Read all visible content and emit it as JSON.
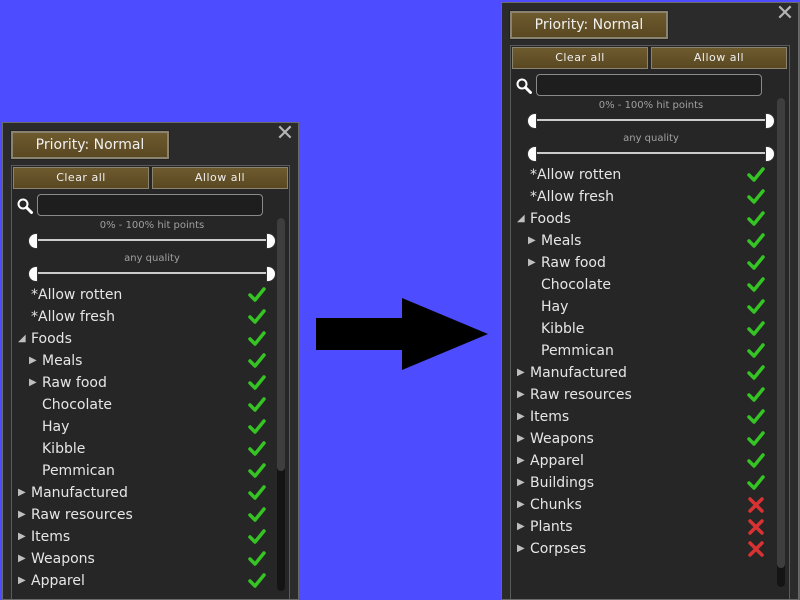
{
  "left": {
    "priority_label": "Priority: Normal",
    "clear_label": "Clear all",
    "allow_label": "Allow all",
    "search_value": "",
    "hitpoints_label": "0% - 100% hit points",
    "quality_label": "any quality",
    "rows": [
      {
        "label": "*Allow rotten",
        "indent": 0,
        "arrow": "none",
        "state": "allowed"
      },
      {
        "label": "*Allow fresh",
        "indent": 0,
        "arrow": "none",
        "state": "allowed"
      },
      {
        "label": "Foods",
        "indent": 0,
        "arrow": "expanded",
        "state": "allowed"
      },
      {
        "label": "Meals",
        "indent": 1,
        "arrow": "collapsed",
        "state": "allowed"
      },
      {
        "label": "Raw food",
        "indent": 1,
        "arrow": "collapsed",
        "state": "allowed"
      },
      {
        "label": "Chocolate",
        "indent": 1,
        "arrow": "none",
        "state": "allowed"
      },
      {
        "label": "Hay",
        "indent": 1,
        "arrow": "none",
        "state": "allowed"
      },
      {
        "label": "Kibble",
        "indent": 1,
        "arrow": "none",
        "state": "allowed"
      },
      {
        "label": "Pemmican",
        "indent": 1,
        "arrow": "none",
        "state": "allowed"
      },
      {
        "label": "Manufactured",
        "indent": 0,
        "arrow": "collapsed",
        "state": "allowed"
      },
      {
        "label": "Raw resources",
        "indent": 0,
        "arrow": "collapsed",
        "state": "allowed"
      },
      {
        "label": "Items",
        "indent": 0,
        "arrow": "collapsed",
        "state": "allowed"
      },
      {
        "label": "Weapons",
        "indent": 0,
        "arrow": "collapsed",
        "state": "allowed"
      },
      {
        "label": "Apparel",
        "indent": 0,
        "arrow": "collapsed",
        "state": "allowed"
      }
    ]
  },
  "right": {
    "priority_label": "Priority: Normal",
    "clear_label": "Clear all",
    "allow_label": "Allow all",
    "search_value": "",
    "hitpoints_label": "0% - 100% hit points",
    "quality_label": "any quality",
    "rows": [
      {
        "label": "*Allow rotten",
        "indent": 0,
        "arrow": "none",
        "state": "allowed"
      },
      {
        "label": "*Allow fresh",
        "indent": 0,
        "arrow": "none",
        "state": "allowed"
      },
      {
        "label": "Foods",
        "indent": 0,
        "arrow": "expanded",
        "state": "allowed"
      },
      {
        "label": "Meals",
        "indent": 1,
        "arrow": "collapsed",
        "state": "allowed"
      },
      {
        "label": "Raw food",
        "indent": 1,
        "arrow": "collapsed",
        "state": "allowed"
      },
      {
        "label": "Chocolate",
        "indent": 1,
        "arrow": "none",
        "state": "allowed"
      },
      {
        "label": "Hay",
        "indent": 1,
        "arrow": "none",
        "state": "allowed"
      },
      {
        "label": "Kibble",
        "indent": 1,
        "arrow": "none",
        "state": "allowed"
      },
      {
        "label": "Pemmican",
        "indent": 1,
        "arrow": "none",
        "state": "allowed"
      },
      {
        "label": "Manufactured",
        "indent": 0,
        "arrow": "collapsed",
        "state": "allowed"
      },
      {
        "label": "Raw resources",
        "indent": 0,
        "arrow": "collapsed",
        "state": "allowed"
      },
      {
        "label": "Items",
        "indent": 0,
        "arrow": "collapsed",
        "state": "allowed"
      },
      {
        "label": "Weapons",
        "indent": 0,
        "arrow": "collapsed",
        "state": "allowed"
      },
      {
        "label": "Apparel",
        "indent": 0,
        "arrow": "collapsed",
        "state": "allowed"
      },
      {
        "label": "Buildings",
        "indent": 0,
        "arrow": "collapsed",
        "state": "allowed"
      },
      {
        "label": "Chunks",
        "indent": 0,
        "arrow": "collapsed",
        "state": "disallowed"
      },
      {
        "label": "Plants",
        "indent": 0,
        "arrow": "collapsed",
        "state": "disallowed"
      },
      {
        "label": "Corpses",
        "indent": 0,
        "arrow": "collapsed",
        "state": "disallowed"
      }
    ]
  },
  "colors": {
    "background": "#4d4cff",
    "panel": "#2b2b2b",
    "button": "#5f4d26",
    "check": "#35c424",
    "cross": "#d83232"
  },
  "icons": {
    "close": "close-icon",
    "search": "search-icon",
    "allowed": "check-icon",
    "disallowed": "cross-icon",
    "transition": "right-arrow-icon"
  }
}
